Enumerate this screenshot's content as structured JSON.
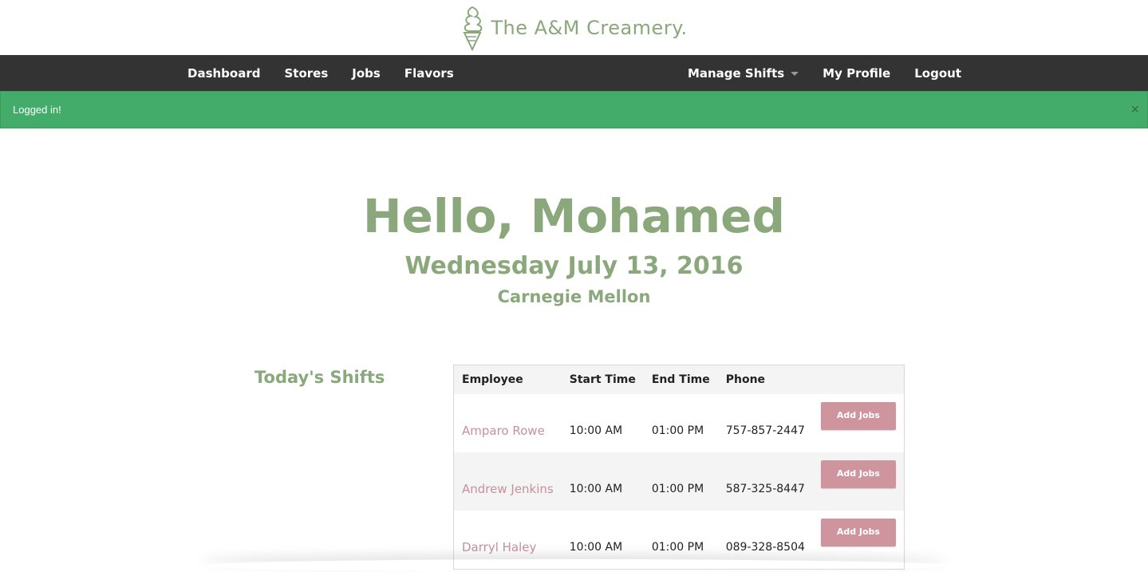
{
  "brand": {
    "name": "The A&M Creamery.",
    "icon": "ice-cream-cone-icon",
    "color": "#8aa87b"
  },
  "nav": {
    "left": [
      "Dashboard",
      "Stores",
      "Jobs",
      "Flavors"
    ],
    "right": {
      "manage_shifts": "Manage Shifts",
      "my_profile": "My Profile",
      "logout": "Logout"
    },
    "background": "#333333"
  },
  "alert": {
    "message": "Logged in!",
    "close_symbol": "×",
    "color": "#43ac6a"
  },
  "hero": {
    "greeting": "Hello, Mohamed",
    "date": "Wednesday July 13, 2016",
    "location": "Carnegie Mellon"
  },
  "shifts": {
    "title": "Today's Shifts",
    "columns": [
      "Employee",
      "Start Time",
      "End Time",
      "Phone"
    ],
    "button_label": "Add Jobs",
    "rows": [
      {
        "employee": "Amparo Rowe",
        "start": "10:00 AM",
        "end": "01:00 PM",
        "phone": "757-857-2447"
      },
      {
        "employee": "Andrew Jenkins",
        "start": "10:00 AM",
        "end": "01:00 PM",
        "phone": "587-325-8447"
      },
      {
        "employee": "Darryl Haley",
        "start": "10:00 AM",
        "end": "01:00 PM",
        "phone": "089-328-8504"
      }
    ],
    "link_color": "#c8909a",
    "button_color": "#cf959f"
  }
}
